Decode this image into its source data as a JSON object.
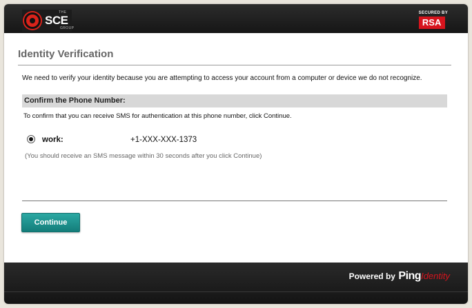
{
  "brand": {
    "logo_the": "THE",
    "logo_name": "SCE",
    "logo_group": "GROUP",
    "secured_by": "SECURED BY",
    "rsa": "RSA",
    "accent_color": "#d7141d"
  },
  "page": {
    "title": "Identity Verification",
    "intro": "We need to verify your identity because you are attempting to access your account from a computer or device we do not recognize."
  },
  "confirm": {
    "header": "Confirm the Phone Number:",
    "description": "To confirm that you can receive SMS for authentication at this phone number, click Continue.",
    "phone": {
      "type_label": "work:",
      "number": "+1-XXX-XXX-1373",
      "selected": true
    },
    "note": "(You should receive an SMS message within 30 seconds after you click Continue)"
  },
  "actions": {
    "continue_label": "Continue",
    "button_color": "#1e928e"
  },
  "footer": {
    "powered_by": "Powered by",
    "ping": "Ping",
    "identity": "Identity"
  }
}
